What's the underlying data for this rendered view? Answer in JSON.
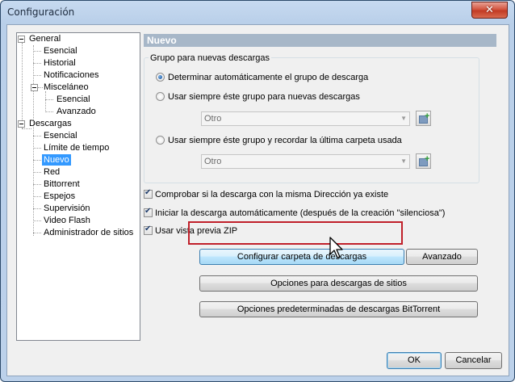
{
  "window": {
    "title": "Configuración",
    "close_label": "✕"
  },
  "tree": {
    "general": "General",
    "esencial": "Esencial",
    "historial": "Historial",
    "notificaciones": "Notificaciones",
    "miscelaneo": "Misceláneo",
    "misc_esencial": "Esencial",
    "misc_avanzado": "Avanzado",
    "descargas": "Descargas",
    "desc_esencial": "Esencial",
    "limite": "Límite de tiempo",
    "nuevo": "Nuevo",
    "red": "Red",
    "bittorrent": "Bittorrent",
    "espejos": "Espejos",
    "supervision": "Supervisión",
    "video_flash": "Video Flash",
    "administrador": "Administrador de sitios"
  },
  "page": {
    "header": "Nuevo",
    "group_label": "Grupo para nuevas descargas",
    "radio1": "Determinar automáticamente el grupo de descarga",
    "radio2": "Usar siempre éste grupo para nuevas descargas",
    "combo1": "Otro",
    "radio3": "Usar siempre éste grupo y recordar la última carpeta usada",
    "combo2": "Otro",
    "check1": "Comprobar si la descarga con la misma Dirección ya existe",
    "check2": "Iniciar la descarga automáticamente (después de la creación \"silenciosa\")",
    "check3": "Usar vista previa ZIP",
    "btn_configurar": "Configurar carpeta de descargas",
    "btn_avanzado": "Avanzado",
    "btn_opciones_sitios": "Opciones para descargas de sitios",
    "btn_opciones_bt": "Opciones predeterminadas de descargas BitTorrent"
  },
  "footer": {
    "ok": "OK",
    "cancel": "Cancelar"
  },
  "colors": {
    "selection": "#3399ff",
    "header_bar": "#a7b7c8",
    "highlight_frame": "#c0202a"
  }
}
